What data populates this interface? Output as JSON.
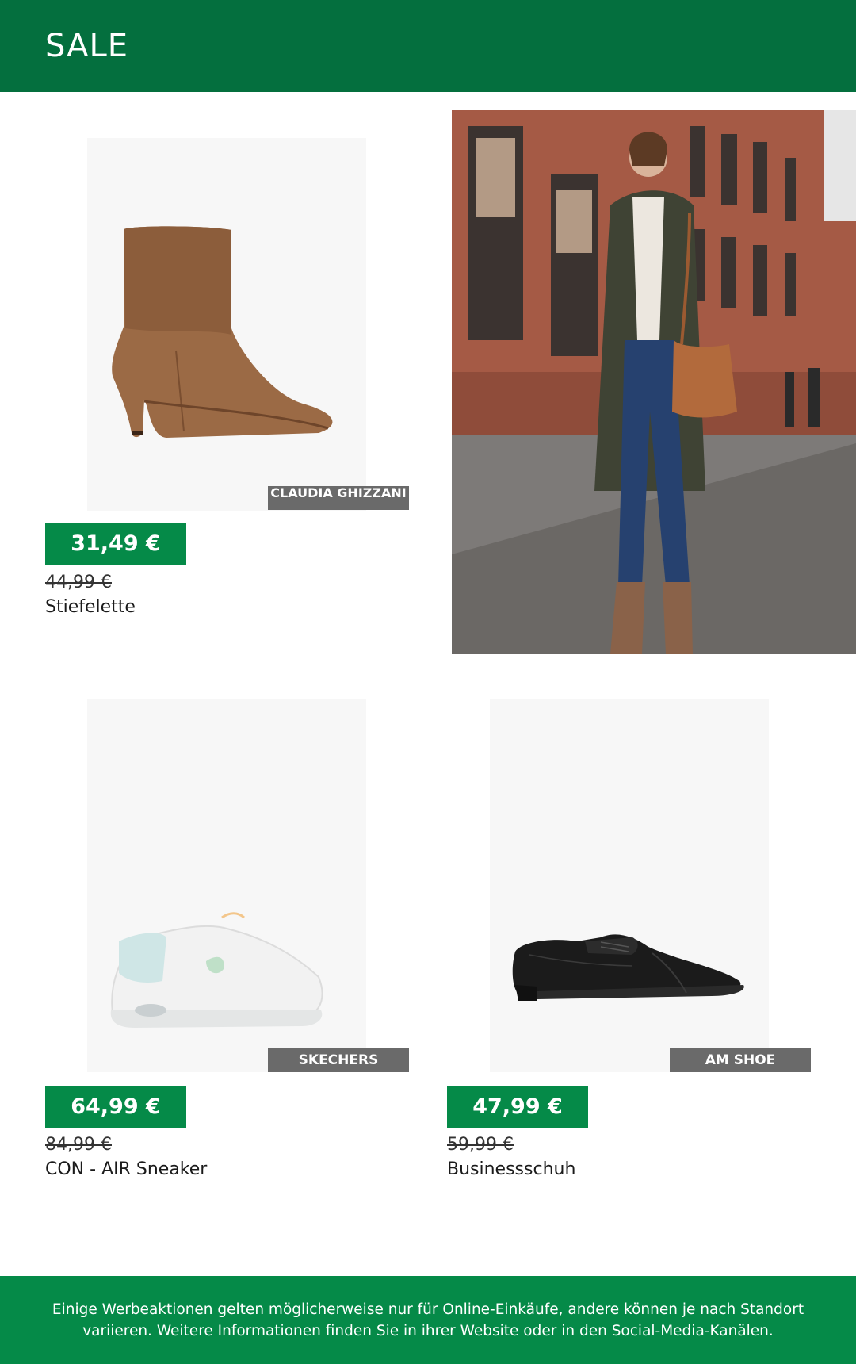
{
  "header": {
    "title": "SALE"
  },
  "products": [
    {
      "brand": "CLAUDIA GHIZZANI",
      "price": "31,49 €",
      "old_price": "44,99 €",
      "name": "Stiefelette",
      "image": "brown-ankle-boot"
    },
    {
      "brand": "SKECHERS",
      "price": "64,99 €",
      "old_price": "84,99 €",
      "name": "CON - AIR Sneaker",
      "image": "white-sneaker"
    },
    {
      "brand": "AM SHOE",
      "price": "47,99 €",
      "old_price": "59,99 €",
      "name": "Businessschuh",
      "image": "black-derby-shoe"
    }
  ],
  "lifestyle_photo": {
    "subject": "woman-street-photo"
  },
  "footer": {
    "text": "Einige Werbeaktionen gelten möglicherweise nur für Online-Einkäufe, andere können je nach Standort variieren. Weitere Informationen finden Sie in ihrer Website oder in den Social-Media-Kanälen."
  },
  "colors": {
    "header_bg": "#046f3e",
    "price_bg": "#058a48",
    "brand_tag_bg": "#6a6a6a",
    "footer_bg": "#058a48"
  }
}
